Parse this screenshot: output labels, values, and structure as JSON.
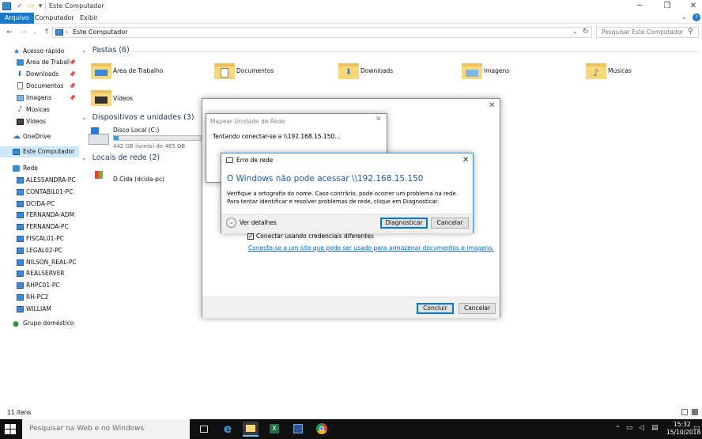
{
  "window": {
    "title": "Este Computador"
  },
  "ribbon": {
    "tabs": [
      "Arquivo",
      "Computador",
      "Exibir"
    ]
  },
  "address": {
    "path": "Este Computador",
    "search_placeholder": "Pesquisar Este Computador"
  },
  "nav": {
    "quick_access": "Acesso rápido",
    "quick_items": [
      "Área de Trabalho",
      "Downloads",
      "Documentos",
      "Imagens",
      "Músicas",
      "Vídeos"
    ],
    "onedrive": "OneDrive",
    "this_pc": "Este Computador",
    "network": "Rede",
    "network_items": [
      "ALESSANDRA-PC",
      "CONTABIL01-PC",
      "DCIDA-PC",
      "FERNANDA-ADM",
      "FERNANDA-PC",
      "FISCAL01-PC",
      "LEGAL02-PC",
      "NILSON_REAL-PC",
      "REALSERVER",
      "RHPC01-PC",
      "RH-PC2",
      "WILLIAM"
    ],
    "homegroup": "Grupo doméstico"
  },
  "groups": {
    "folders_header": "Pastas (6)",
    "folders": [
      "Área de Trabalho",
      "Documentos",
      "Downloads",
      "Imagens",
      "Músicas",
      "Vídeos"
    ],
    "devices_header": "Dispositivos e unidades (3)",
    "disk_name": "Disco Local (C:)",
    "disk_free": "442 GB livre(s) de 465 GB",
    "disk_used_fraction": 0.05,
    "network_header": "Locais de rede (2)",
    "network_location": "D.Cida (dcida-pc)"
  },
  "status": {
    "items": "11 itens"
  },
  "map_drive": {
    "checkbox_label": "Conectar usando credenciais diferentes",
    "link": "Conecte-se a um site que pode ser usado para armazenar documentos e imagens.",
    "finish": "Concluir",
    "cancel": "Cancelar"
  },
  "connecting": {
    "title": "Mapear Unidade de Rede",
    "message": "Tentando conectar-se a \\\\192.168.15.150..."
  },
  "error": {
    "title": "Erro de rede",
    "heading": "O Windows não pode acessar \\\\192.168.15.150",
    "body": "Verifique a ortografia do nome. Caso contrário, pode ocorrer um problema na rede. Para tentar identificar e resolver problemas de rede, clique em Diagnosticar.",
    "details": "Ver detalhes",
    "diagnose": "Diagnosticar",
    "cancel": "Cancelar"
  },
  "taskbar": {
    "search_placeholder": "Pesquisar na Web e no Windows",
    "time": "15:32",
    "date": "15/10/2018"
  },
  "colors": {
    "accent": "#1979ca",
    "heading_blue": "#1e5aa8",
    "folder": "#f8d775",
    "disk_bar": "#26a0da"
  }
}
